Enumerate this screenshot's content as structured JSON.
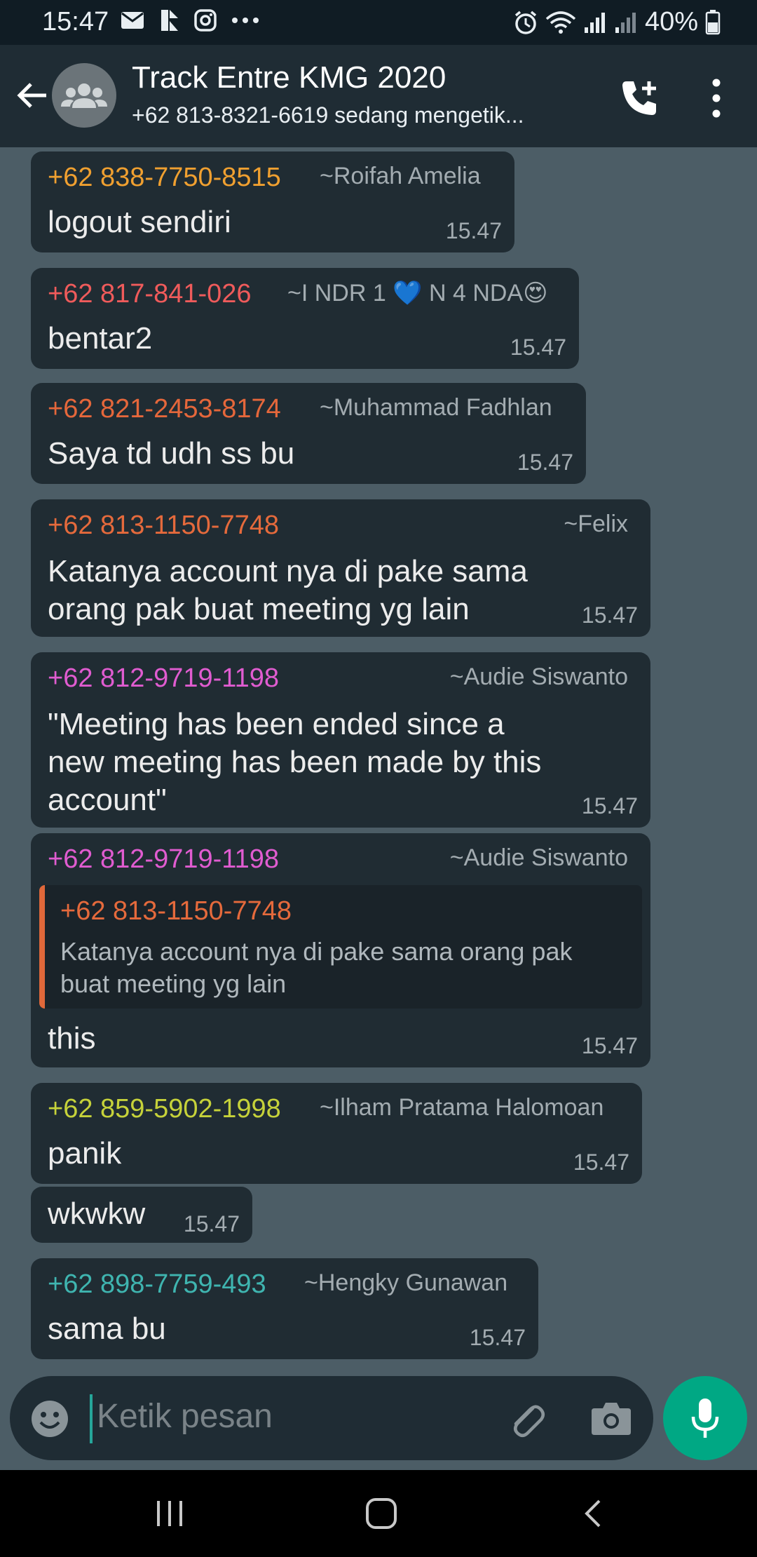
{
  "status_bar": {
    "time": "15:47",
    "battery": "40%",
    "icons_left": [
      "mail-icon",
      "app-icon",
      "instagram-icon",
      "more-icon"
    ],
    "icons_right": [
      "alarm-icon",
      "wifi-icon",
      "signal-icon",
      "signal-icon",
      "battery-icon"
    ]
  },
  "header": {
    "title": "Track Entre KMG 2020",
    "subtitle": "+62 813-8321-6619 sedang mengetik..."
  },
  "colors": {
    "chat_bg": "#4c5d66",
    "bubble": "#202c33",
    "header": "#1f2c34",
    "accent": "#00a884"
  },
  "messages": [
    {
      "phone": "+62 838-7750-8515",
      "name": "~Roifah Amelia",
      "text": [
        "logout sendiri"
      ],
      "time": "15.47",
      "color": "#f0a030"
    },
    {
      "phone": "+62 817-841-026",
      "name": "~I NDR 1 💙 N 4 NDA😍",
      "text": [
        "bentar2"
      ],
      "time": "15.47",
      "color": "#ef5b5b"
    },
    {
      "phone": "+62 821-2453-8174",
      "name": "~Muhammad Fadhlan",
      "text": [
        "Saya td udh ss bu"
      ],
      "time": "15.47",
      "color": "#e5673b"
    },
    {
      "phone": "+62 813-1150-7748",
      "name": "~Felix",
      "text": [
        "Katanya account nya di pake sama",
        "orang pak buat meeting yg lain"
      ],
      "time": "15.47",
      "color": "#e56a3c"
    },
    {
      "phone": "+62 812-9719-1198",
      "name": "~Audie Siswanto",
      "text": [
        "\"Meeting has been ended since a",
        "new meeting has been made by this",
        "account\""
      ],
      "time": "15.47",
      "color": "#e05cd0"
    },
    {
      "phone": "+62 812-9719-1198",
      "name": "~Audie Siswanto",
      "quote": {
        "phone": "+62 813-1150-7748",
        "text": [
          "Katanya account nya di pake sama orang pak",
          "buat meeting yg lain"
        ]
      },
      "text": [
        "this"
      ],
      "time": "15.47",
      "color": "#e05cd0"
    },
    {
      "phone": "+62 859-5902-1998",
      "name": "~Ilham Pratama Halomoan",
      "text": [
        "panik"
      ],
      "time": "15.47",
      "color": "#c6d23a"
    },
    {
      "text": [
        "wkwkw"
      ],
      "time": "15.47"
    },
    {
      "phone": "+62 898-7759-493",
      "name": "~Hengky Gunawan",
      "text": [
        "sama bu"
      ],
      "time": "15.47",
      "color": "#3fb5b0"
    }
  ],
  "input": {
    "placeholder": "Ketik pesan"
  }
}
